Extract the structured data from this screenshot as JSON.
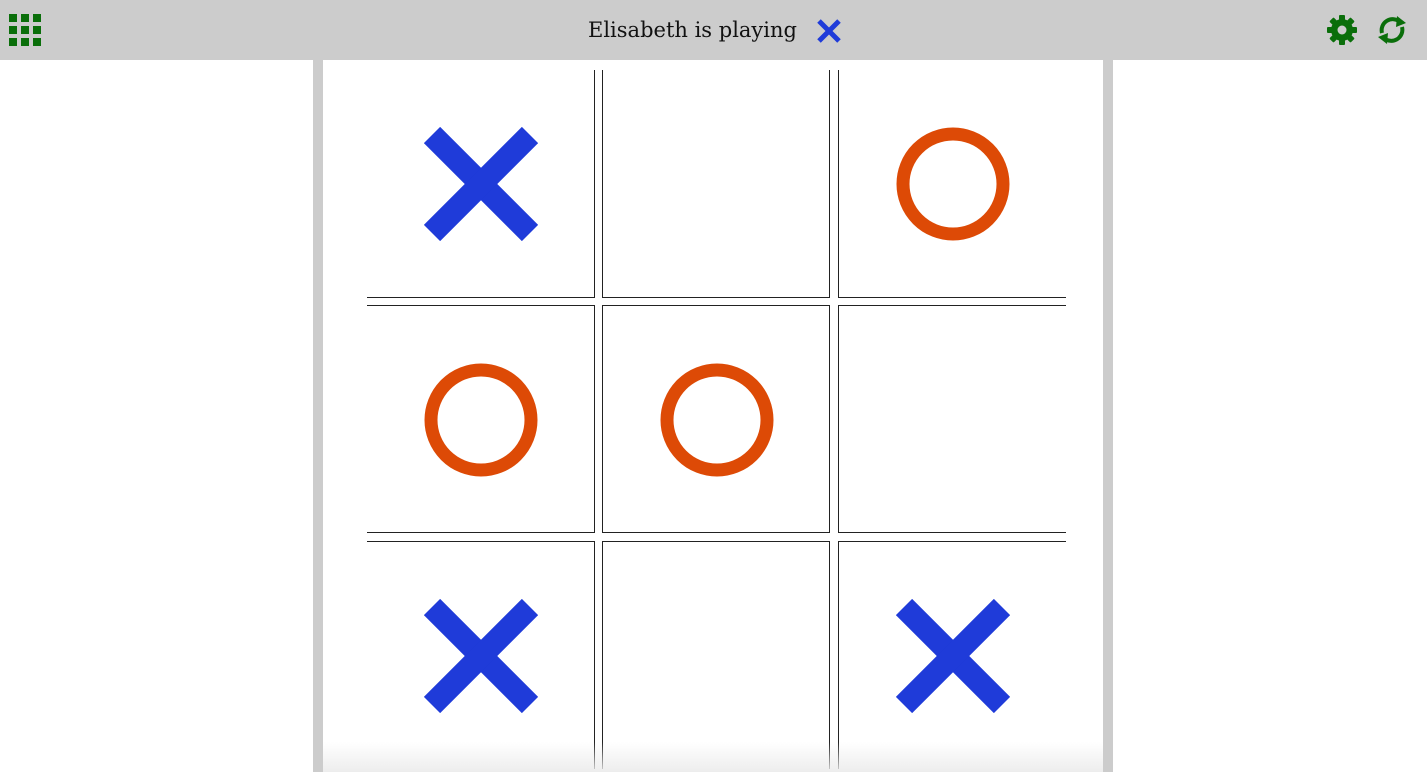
{
  "header": {
    "status_text": "Elisabeth is playing",
    "current_player_mark": "X"
  },
  "icons": {
    "apps": "apps-grid-icon",
    "settings": "gear-icon",
    "restart": "refresh-icon"
  },
  "colors": {
    "bar": "#cccccc",
    "icon_green": "#0a6e0a",
    "x_blue": "#1f3bd9",
    "o_orange": "#dd4a06"
  },
  "board": {
    "cells": [
      "X",
      "",
      "O",
      "O",
      "O",
      "",
      "X",
      "",
      "X"
    ]
  }
}
